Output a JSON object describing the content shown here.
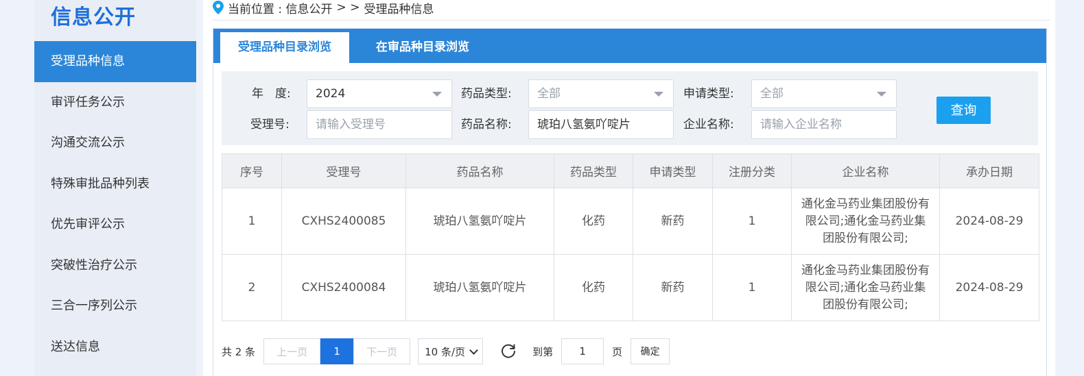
{
  "sidebar": {
    "title": "信息公开",
    "items": [
      {
        "label": "受理品种信息"
      },
      {
        "label": "审评任务公示"
      },
      {
        "label": "沟通交流公示"
      },
      {
        "label": "特殊审批品种列表"
      },
      {
        "label": "优先审评公示"
      },
      {
        "label": "突破性治疗公示"
      },
      {
        "label": "三合一序列公示"
      },
      {
        "label": "送达信息"
      }
    ]
  },
  "breadcrumb": {
    "prefix": "当前位置 : 信息公开",
    "sep": "> >",
    "current": "受理品种信息"
  },
  "tabs": [
    {
      "label": "受理品种目录浏览"
    },
    {
      "label": "在审品种目录浏览"
    }
  ],
  "filters": {
    "year_label": "年　度:",
    "year_value": "2024",
    "drug_type_label": "药品类型:",
    "drug_type_value": "全部",
    "apply_type_label": "申请类型:",
    "apply_type_value": "全部",
    "accept_no_label": "受理号:",
    "accept_no_placeholder": "请输入受理号",
    "drug_name_label": "药品名称:",
    "drug_name_value": "琥珀八氢氨吖啶片",
    "company_label": "企业名称:",
    "company_placeholder": "请输入企业名称",
    "query_label": "查询"
  },
  "table": {
    "headers": [
      "序号",
      "受理号",
      "药品名称",
      "药品类型",
      "申请类型",
      "注册分类",
      "企业名称",
      "承办日期"
    ],
    "rows": [
      [
        "1",
        "CXHS2400085",
        "琥珀八氢氨吖啶片",
        "化药",
        "新药",
        "1",
        "通化金马药业集团股份有限公司;通化金马药业集团股份有限公司;",
        "2024-08-29"
      ],
      [
        "2",
        "CXHS2400084",
        "琥珀八氢氨吖啶片",
        "化药",
        "新药",
        "1",
        "通化金马药业集团股份有限公司;通化金马药业集团股份有限公司;",
        "2024-08-29"
      ]
    ]
  },
  "pager": {
    "total": "共 2 条",
    "prev": "上一页",
    "current": "1",
    "next": "下一页",
    "page_size": "10 条/页",
    "goto_label": "到第",
    "goto_value": "1",
    "page_unit": "页",
    "confirm": "确定"
  },
  "colors": {
    "accent": "#2b86d9",
    "query_button": "#1aa0ee",
    "title": "#1e6fd9"
  }
}
